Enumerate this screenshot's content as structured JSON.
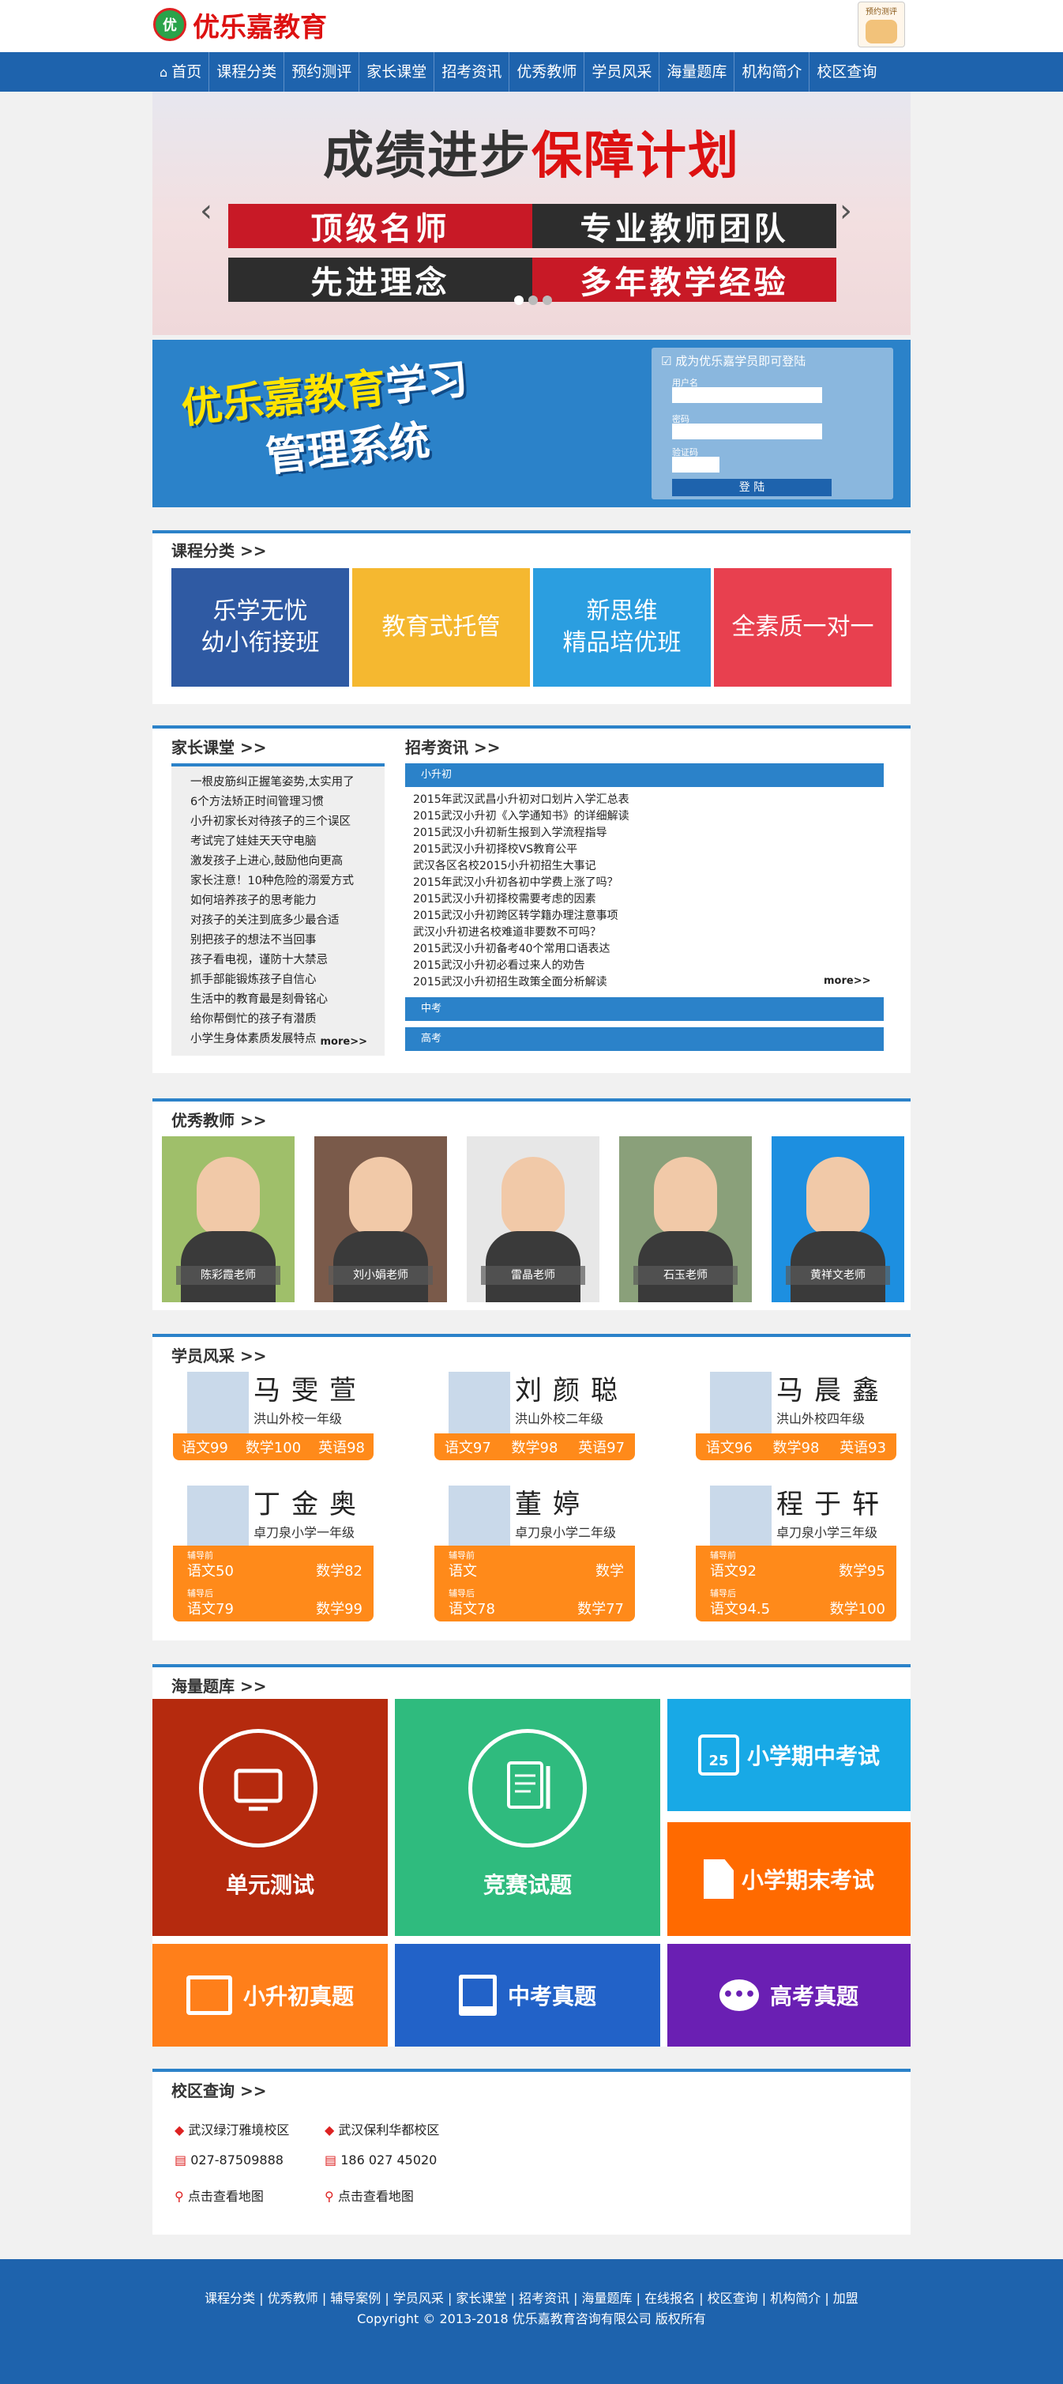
{
  "header": {
    "logo_badge": "优",
    "logo_text": "优乐嘉教育",
    "eval_label": "预约测评"
  },
  "nav": [
    "首页",
    "课程分类",
    "预约测评",
    "家长课堂",
    "招考资讯",
    "优秀教师",
    "学员风采",
    "海量题库",
    "机构简介",
    "校区查询"
  ],
  "banner": {
    "title_dark": "成绩进步",
    "title_red": "保障计划",
    "cells": [
      "顶级名师",
      "专业教师团队",
      "先进理念",
      "多年教学经验"
    ]
  },
  "lms": {
    "line1_a": "优乐嘉教育",
    "line1_b": "学习",
    "line2": "管理系统",
    "login_head": "成为优乐嘉学员即可登陆",
    "username_label": "用户名",
    "password_label": "密码",
    "captcha_label": "验证码",
    "login_button": "登 陆"
  },
  "courses": {
    "title": "课程分类  >>",
    "tiles": [
      {
        "l1": "乐学无忧",
        "l2": "幼小衔接班",
        "color": "#2f5aa3"
      },
      {
        "l1": "教育式托管",
        "l2": "",
        "color": "#f5b830"
      },
      {
        "l1": "新思维",
        "l2": "精品培优班",
        "color": "#2b9ee0"
      },
      {
        "l1": "全素质一对一",
        "l2": "",
        "color": "#e8404f"
      }
    ]
  },
  "parents": {
    "title": "家长课堂  >>",
    "items": [
      "一根皮筋纠正握笔姿势,太实用了",
      "6个方法矫正时间管理习惯",
      "小升初家长对待孩子的三个误区",
      "考试完了娃娃天天守电脑",
      "激发孩子上进心,鼓励他向更高",
      "家长注意！10种危险的溺爱方式",
      "如何培养孩子的思考能力",
      "对孩子的关注到底多少最合适",
      "别把孩子的想法不当回事",
      "孩子看电视，谨防十大禁忌",
      "抓手部能锻炼孩子自信心",
      "生活中的教育最是刻骨铭心",
      "给你帮倒忙的孩子有潜质",
      "小学生身体素质发展特点"
    ],
    "more": "more>>"
  },
  "exams": {
    "title": "招考资讯  >>",
    "tab1": "小升初",
    "items": [
      "2015年武汉武昌小升初对口划片入学汇总表",
      "2015武汉小升初《入学通知书》的详细解读",
      "2015武汉小升初新生报到入学流程指导",
      "2015武汉小升初择校VS教育公平",
      "武汉各区名校2015小升初招生大事记",
      "2015年武汉小升初各初中学费上涨了吗？",
      "2015武汉小升初择校需要考虑的因素",
      "2015武汉小升初跨区转学籍办理注意事项",
      "武汉小升初进名校难道非要数不可吗？",
      "2015武汉小升初备考40个常用口语表达",
      "2015武汉小升初必看过来人的劝告",
      "2015武汉小升初招生政策全面分析解读"
    ],
    "more": "more>>",
    "tab2": "中考",
    "tab3": "高考"
  },
  "teachers": {
    "title": "优秀教师  >>",
    "list": [
      {
        "name": "陈彩霞老师",
        "bg": "#9fbf6a"
      },
      {
        "name": "刘小娟老师",
        "bg": "#7a5a4a"
      },
      {
        "name": "雷晶老师",
        "bg": "#e7e7e7"
      },
      {
        "name": "石玉老师",
        "bg": "#8aa07a"
      },
      {
        "name": "黄祥文老师",
        "bg": "#1d8fe0"
      }
    ]
  },
  "students": {
    "title": "学员风采  >>",
    "top": [
      {
        "name": "马雯萱",
        "school": "洪山外校一年级",
        "scores": [
          "语文99",
          "数学100",
          "英语98"
        ]
      },
      {
        "name": "刘颜聪",
        "school": "洪山外校二年级",
        "scores": [
          "语文97",
          "数学98",
          "英语97"
        ]
      },
      {
        "name": "马晨鑫",
        "school": "洪山外校四年级",
        "scores": [
          "语文96",
          "数学98",
          "英语93"
        ]
      }
    ],
    "bottom": [
      {
        "name": "丁金奥",
        "school": "卓刀泉小学一年级",
        "before": "辅导前",
        "before_cn": "语文50",
        "before_math": "数学82",
        "after": "辅导后",
        "after_cn": "语文79",
        "after_math": "数学99"
      },
      {
        "name": "董婷",
        "school": "卓刀泉小学二年级",
        "before": "辅导前",
        "before_cn": "语文",
        "before_math": "数学",
        "after": "辅导后",
        "after_cn": "语文78",
        "after_math": "数学77"
      },
      {
        "name": "程于轩",
        "school": "卓刀泉小学三年级",
        "before": "辅导前",
        "before_cn": "语文92",
        "before_math": "数学95",
        "after": "辅导后",
        "after_cn": "语文94.5",
        "after_math": "数学100"
      }
    ]
  },
  "questionbank": {
    "title": "海量题库  >>",
    "unit": "单元测试",
    "contest": "竞赛试题",
    "mid": "小学期中考试",
    "mid_day": "25",
    "final": "小学期末考试",
    "xsc": "小升初真题",
    "zk": "中考真题",
    "gk": "高考真题",
    "colors": {
      "unit": "#b52a0e",
      "contest": "#2fbb7e",
      "mid": "#18a9e6",
      "final": "#ff6a00",
      "xsc": "#ff7f1a",
      "zk": "#2262c8",
      "gk": "#6a1fb3"
    }
  },
  "campus": {
    "title": "校区查询  >>",
    "c1": {
      "name": "武汉绿汀雅境校区",
      "phone": "027-87509888",
      "map": "点击查看地图"
    },
    "c2": {
      "name": "武汉保利华都校区",
      "phone": "186 027 45020",
      "map": "点击查看地图"
    }
  },
  "footer": {
    "links": "课程分类 | 优秀教师 | 辅导案例 | 学员风采 | 家长课堂 | 招考资讯 | 海量题库 | 在线报名 | 校区查询 | 机构简介 | 加盟",
    "copyright": "Copyright © 2013-2018 优乐嘉教育咨询有限公司 版权所有"
  }
}
